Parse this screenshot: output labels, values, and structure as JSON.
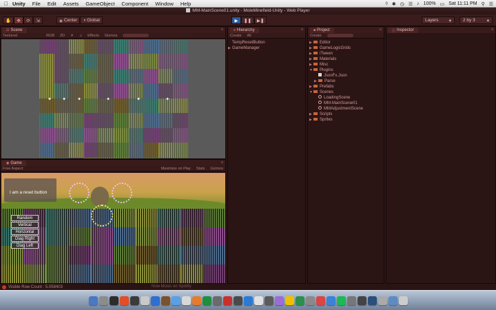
{
  "menubar": {
    "app_name": "Unity",
    "items": [
      "File",
      "Edit",
      "Assets",
      "GameObject",
      "Component",
      "Window",
      "Help"
    ],
    "battery": "100%",
    "clock": "Sat 11:11 PM"
  },
  "window": {
    "title": "MM-MainScene01.unity - MoleMinefield-Unity - Web Player"
  },
  "toolbar": {
    "pivot_label": "Center",
    "space_label": "Global",
    "layers_label": "Layers",
    "layout_label": "2 by 3"
  },
  "scene": {
    "tab_label": "Scene",
    "shading_mode": "Textured",
    "render_mode": "RGB",
    "mode_2d": "2D",
    "effects_label": "Effects",
    "gizmos_label": "Gizmos"
  },
  "game": {
    "tab_label": "Game",
    "aspect_label": "Free Aspect",
    "maximize_label": "Maximize on Play",
    "stats_label": "Stats",
    "gizmos_label": "Gizmos",
    "reset_button_label": "I am a reset button",
    "mode_buttons": [
      "Random",
      "Vertical",
      "Horizontal",
      "Diag Right",
      "Diag Left"
    ]
  },
  "hierarchy": {
    "tab_label": "Hierarchy",
    "create_label": "Create",
    "search_placeholder": "All",
    "items": [
      "TempResetButton",
      "GameManager"
    ]
  },
  "project": {
    "tab_label": "Project",
    "create_label": "Create",
    "items": [
      {
        "label": "Editor",
        "depth": 0,
        "kind": "folder",
        "expanded": false
      },
      {
        "label": "GameLogicGrids",
        "depth": 0,
        "kind": "folder",
        "expanded": false
      },
      {
        "label": "iTween",
        "depth": 0,
        "kind": "folder",
        "expanded": false
      },
      {
        "label": "Materials",
        "depth": 0,
        "kind": "folder",
        "expanded": false
      },
      {
        "label": "Misc",
        "depth": 0,
        "kind": "folder",
        "expanded": false
      },
      {
        "label": "Plugins",
        "depth": 0,
        "kind": "folder",
        "expanded": true
      },
      {
        "label": "JsonFx.Json",
        "depth": 1,
        "kind": "file",
        "expanded": false
      },
      {
        "label": "Parse",
        "depth": 1,
        "kind": "folder",
        "expanded": false
      },
      {
        "label": "Prefabs",
        "depth": 0,
        "kind": "folder",
        "expanded": false
      },
      {
        "label": "Scenes",
        "depth": 0,
        "kind": "folder",
        "expanded": true
      },
      {
        "label": "LoadingScene",
        "depth": 1,
        "kind": "unity",
        "expanded": false
      },
      {
        "label": "MM-MainScene01",
        "depth": 1,
        "kind": "unity",
        "expanded": false
      },
      {
        "label": "MMAdjustmentScene",
        "depth": 1,
        "kind": "unity",
        "expanded": false
      },
      {
        "label": "Scripts",
        "depth": 0,
        "kind": "folder",
        "expanded": false
      },
      {
        "label": "Sprites",
        "depth": 0,
        "kind": "folder",
        "expanded": false
      }
    ]
  },
  "inspector": {
    "tab_label": "Inspector"
  },
  "statusbar": {
    "message": "Visible Row Count : 5.058403",
    "ticker": "Now Music on Spotify"
  },
  "colors": {
    "editor_background": "#2b1414",
    "tab_background": "#4b2323",
    "play_button": "#2b5a9c",
    "scene_background": "#5a5a5a",
    "folder": "#c8653a"
  },
  "icons": {
    "apple": "apple-icon",
    "hand_tool": "hand-tool-icon",
    "move_tool": "move-tool-icon",
    "rotate_tool": "rotate-tool-icon",
    "scale_tool": "scale-tool-icon",
    "play": "play-icon",
    "pause": "pause-icon",
    "step": "step-icon",
    "warning": "warning-icon"
  }
}
